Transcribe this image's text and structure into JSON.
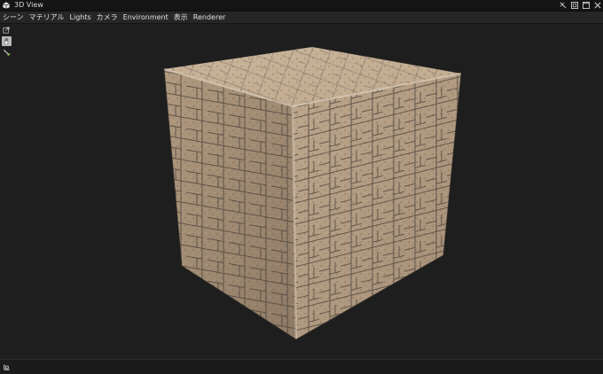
{
  "window": {
    "title": "3D View",
    "icon": "cube-icon",
    "controls": [
      "pin-icon",
      "restore-icon",
      "maximize-icon",
      "close-icon"
    ]
  },
  "menu": [
    {
      "id": "scene",
      "label": "シーン"
    },
    {
      "id": "material",
      "label": "マテリアル"
    },
    {
      "id": "lights",
      "label": "Lights"
    },
    {
      "id": "camera",
      "label": "カメラ"
    },
    {
      "id": "environment",
      "label": "Environment"
    },
    {
      "id": "display",
      "label": "表示"
    },
    {
      "id": "renderer",
      "label": "Renderer"
    }
  ],
  "tools": [
    {
      "id": "external-view",
      "icon": "external-link-icon",
      "active": false
    },
    {
      "id": "hand",
      "icon": "hand-icon",
      "active": true
    },
    {
      "id": "picker",
      "icon": "eyedropper-icon",
      "active": false
    }
  ],
  "viewport": {
    "model": "tiled cube",
    "material": "stone herringbone tiles",
    "background_color": "#1e1e1e"
  },
  "status": {
    "icon": "axis-gizmo-icon"
  },
  "colors": {
    "titlebar": "#141414",
    "menubar": "#262626",
    "viewport": "#1e1e1e",
    "tile_light": "#c8b8a0",
    "tile_dark": "#8a6a4a",
    "grout": "#4a4540"
  }
}
